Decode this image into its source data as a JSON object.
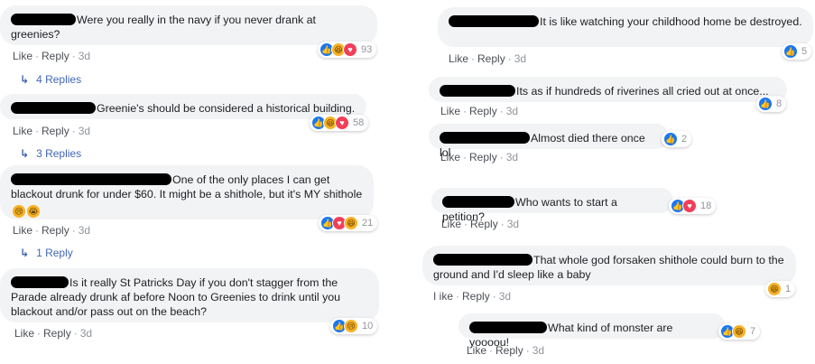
{
  "actions": {
    "like": "Like",
    "reply": "Reply",
    "time": "3d",
    "sep": "·",
    "like_variant": "I ike"
  },
  "icons": {
    "reply_arrow": "reply-arrow-icon",
    "like": "thumbs-up-icon",
    "haha": "laughing-face-icon",
    "love": "heart-icon",
    "sad": "crying-face-icon"
  },
  "colors": {
    "bubble": "#f2f3f5",
    "link": "#4267b2",
    "like": "#1877f2",
    "love": "#f33e58",
    "haha": "#f7b125",
    "meta": "#90949c"
  },
  "left": [
    {
      "text": "Were you really in the navy if you never drank at greenies?",
      "reactions_count": "93",
      "replies": "4 Replies"
    },
    {
      "text": "Greenie's should be considered a historical building.",
      "reactions_count": "58",
      "replies": "3 Replies"
    },
    {
      "text": "One of the only places I can get blackout drunk for under $60. It might be a shithole, but it's MY shithole",
      "reactions_count": "21",
      "replies": "1 Reply"
    },
    {
      "text": "Is it really St Patricks Day if you don't stagger from the Parade already drunk af before Noon to Greenies to drink until you blackout and/or pass out on the beach?",
      "reactions_count": "10"
    }
  ],
  "right": [
    {
      "text": "It is like watching your childhood home be destroyed.",
      "reactions_count": "5"
    },
    {
      "text": "Its as if hundreds of riverines all cried out at once...",
      "reactions_count": "8"
    },
    {
      "text": "Almost died there once lol",
      "reactions_count": "2"
    },
    {
      "text": "Who wants to start a petition?",
      "reactions_count": "18"
    },
    {
      "text": "That whole god forsaken shithole could burn to the ground and I'd sleep like a baby",
      "reactions_count": "1"
    },
    {
      "text": "What kind of monster are yoooou!",
      "reactions_count": "7"
    }
  ]
}
